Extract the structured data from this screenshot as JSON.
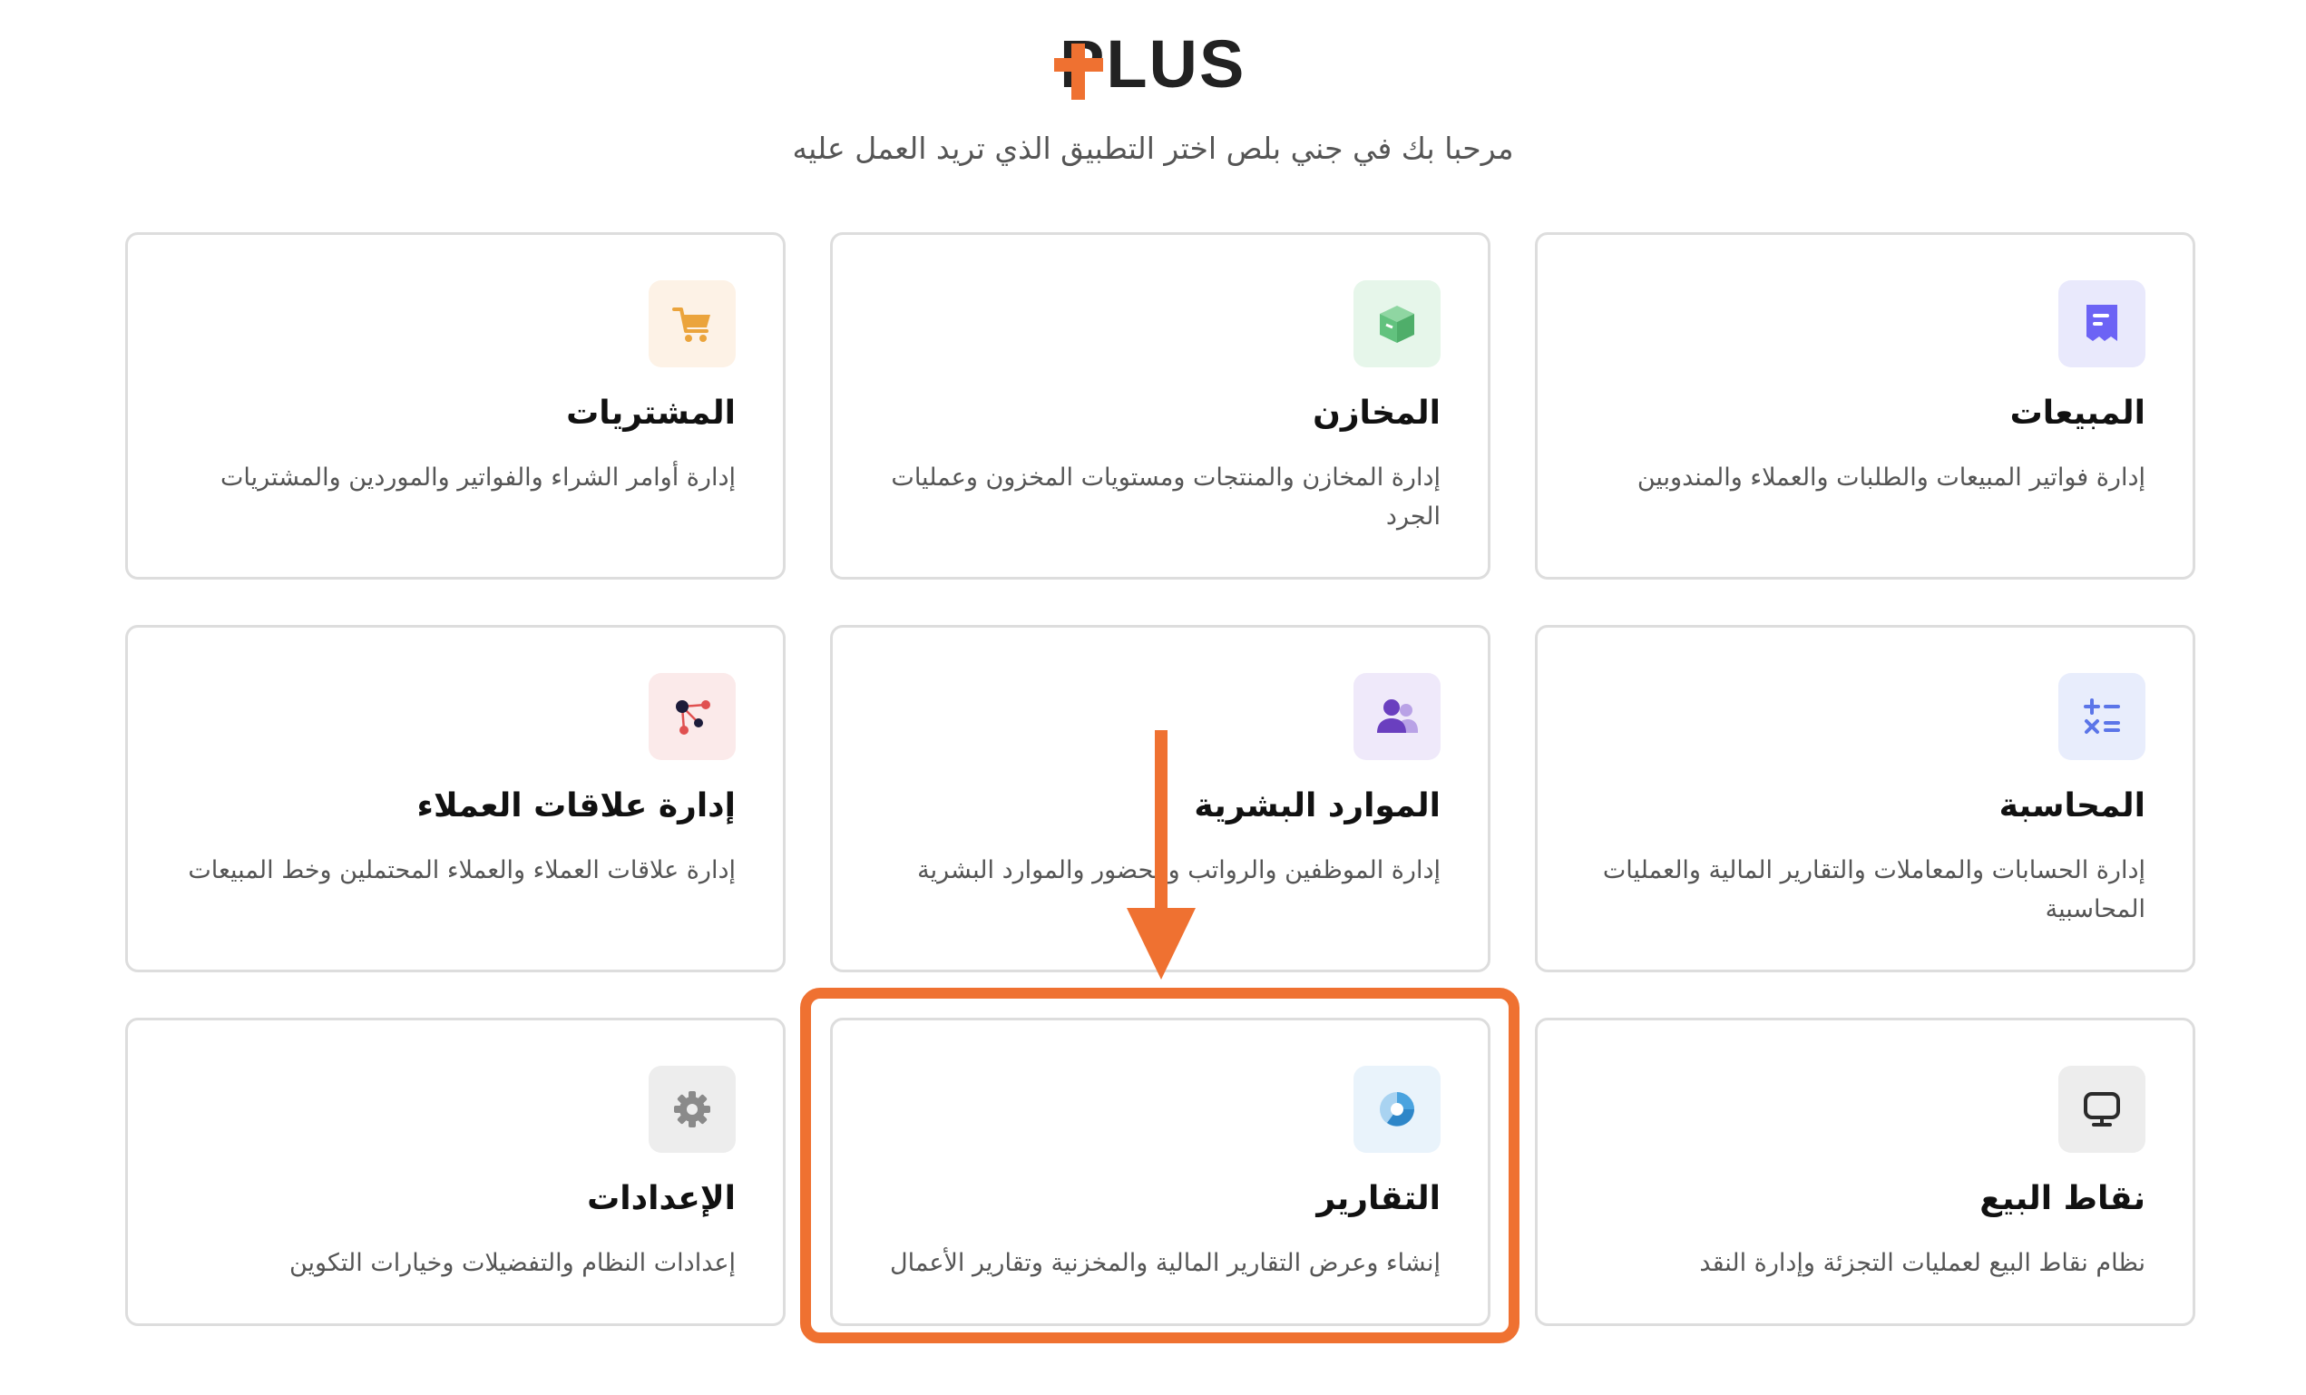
{
  "header": {
    "logo_text": "PLUS",
    "welcome": "مرحبا بك في جني بلص اختر التطبيق الذي تريد العمل عليه"
  },
  "apps": [
    {
      "title": "المبيعات",
      "description": "إدارة فواتير المبيعات والطلبات والعملاء والمندوبين",
      "icon": "receipt-icon",
      "color": "#6c63f5"
    },
    {
      "title": "المخازن",
      "description": "إدارة المخازن والمنتجات ومستويات المخزون وعمليات الجرد",
      "icon": "box-icon",
      "color": "#62c27e"
    },
    {
      "title": "المشتريات",
      "description": "إدارة أوامر الشراء والفواتير والموردين والمشتريات",
      "icon": "shopping-cart-icon",
      "color": "#eba43c"
    },
    {
      "title": "المحاسبة",
      "description": "إدارة الحسابات والمعاملات والتقارير المالية والعمليات المحاسبية",
      "icon": "calculator-icon",
      "color": "#5b75e8"
    },
    {
      "title": "الموارد البشرية",
      "description": "إدارة الموظفين والرواتب والحضور والموارد البشرية",
      "icon": "users-icon",
      "color": "#6a3fbf"
    },
    {
      "title": "إدارة علاقات العملاء",
      "description": "إدارة علاقات العملاء والعملاء المحتملين وخط المبيعات",
      "icon": "network-icon",
      "color": "#e05050"
    },
    {
      "title": "نقاط البيع",
      "description": "نظام نقاط البيع لعمليات التجزئة وإدارة النقد",
      "icon": "monitor-icon",
      "color": "#2b2b2b"
    },
    {
      "title": "التقارير",
      "description": "إنشاء وعرض التقارير المالية والمخزنية وتقارير الأعمال",
      "icon": "pie-chart-icon",
      "color": "#4aa3df"
    },
    {
      "title": "الإعدادات",
      "description": "إعدادات النظام والتفضيلات وخيارات التكوين",
      "icon": "gear-icon",
      "color": "#8a8a8a"
    }
  ],
  "annotation": {
    "color": "#ef7131",
    "highlighted_app": "التقارير"
  }
}
